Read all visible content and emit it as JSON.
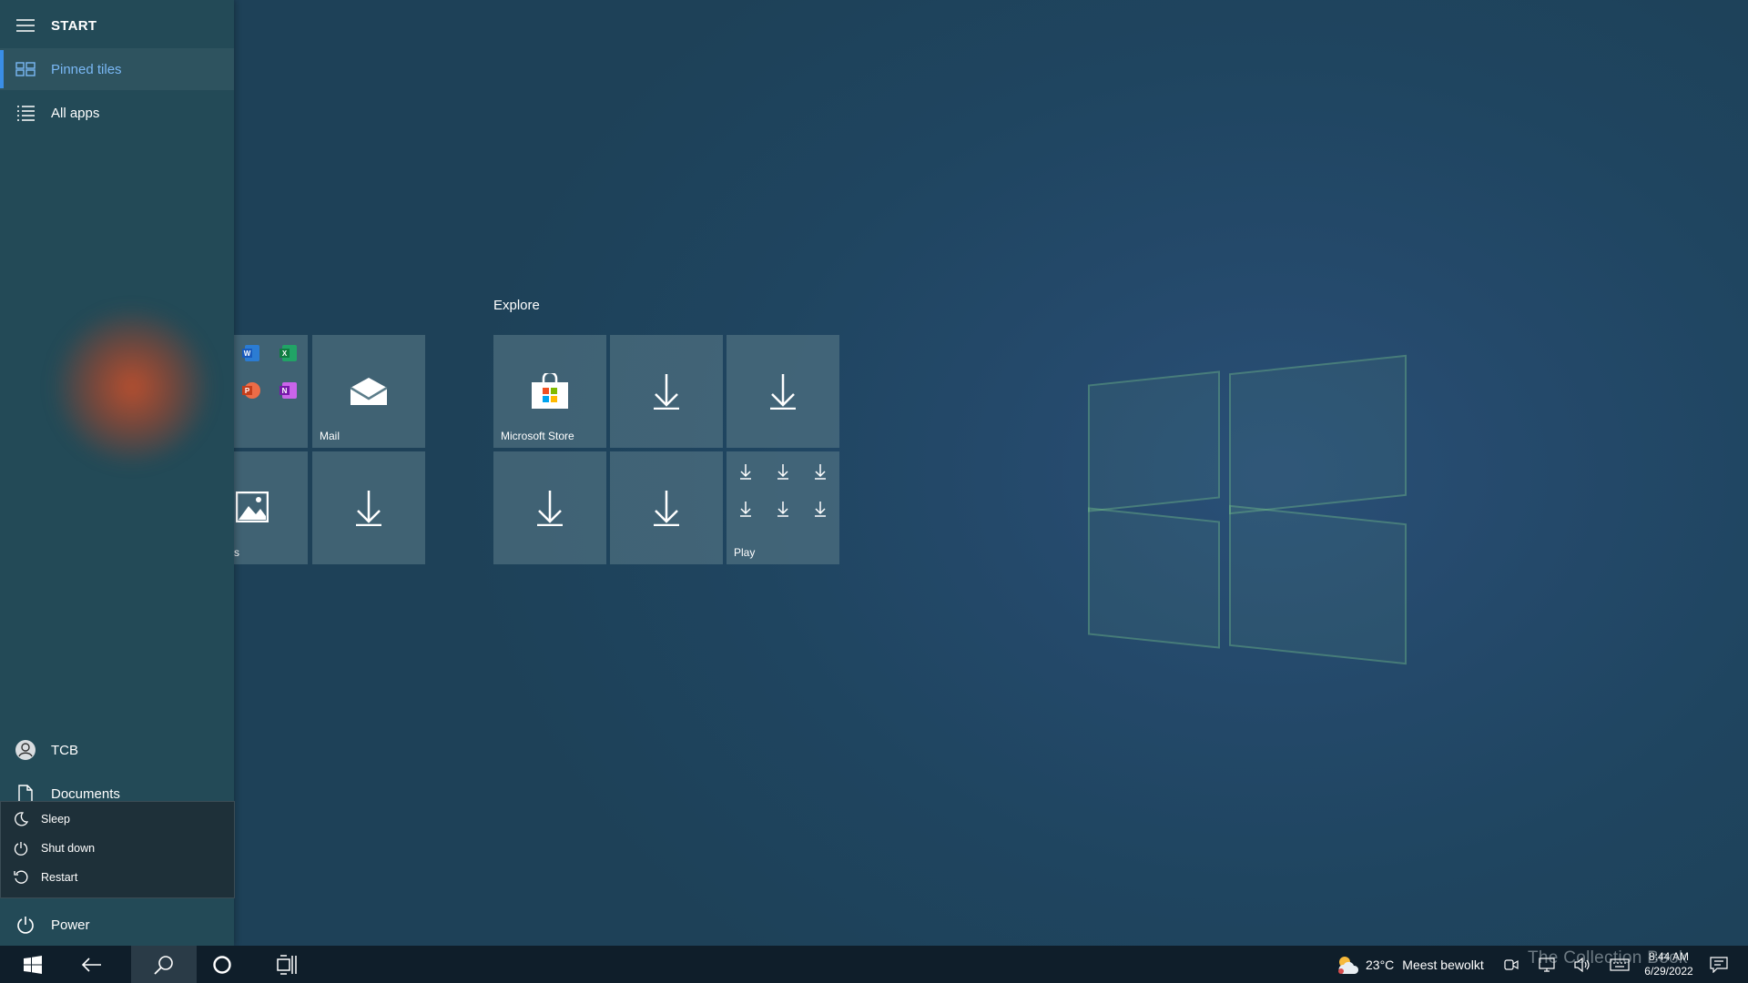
{
  "start_menu": {
    "title": "START",
    "nav": {
      "pinned_tiles": "Pinned tiles",
      "all_apps": "All apps"
    },
    "user": {
      "name": "TCB"
    },
    "documents": "Documents",
    "power": "Power",
    "power_menu": {
      "sleep": "Sleep",
      "shut_down": "Shut down",
      "restart": "Restart"
    }
  },
  "tiles": {
    "left_group": {
      "mail": "Mail",
      "photos_partial": "s"
    },
    "explore": {
      "title": "Explore",
      "microsoft_store": "Microsoft Store",
      "play": "Play"
    }
  },
  "taskbar": {
    "weather": {
      "temp": "23°C",
      "condition": "Meest bewolkt"
    },
    "clock": {
      "time": "8:44 AM",
      "date": "6/29/2022"
    }
  },
  "watermark": "The Collection Book",
  "icons": [
    "hamburger-icon",
    "pinned-tiles-icon",
    "all-apps-icon",
    "user-avatar-icon",
    "document-icon",
    "sleep-icon",
    "shutdown-icon",
    "restart-icon",
    "power-icon",
    "mail-icon",
    "word-icon",
    "excel-icon",
    "powerpoint-icon",
    "onenote-icon",
    "photos-icon",
    "download-icon",
    "store-icon",
    "windows-logo-icon",
    "back-icon",
    "search-icon",
    "cortana-icon",
    "task-view-icon",
    "weather-icon",
    "meet-icon",
    "network-icon",
    "volume-icon",
    "keyboard-icon",
    "notification-icon"
  ]
}
